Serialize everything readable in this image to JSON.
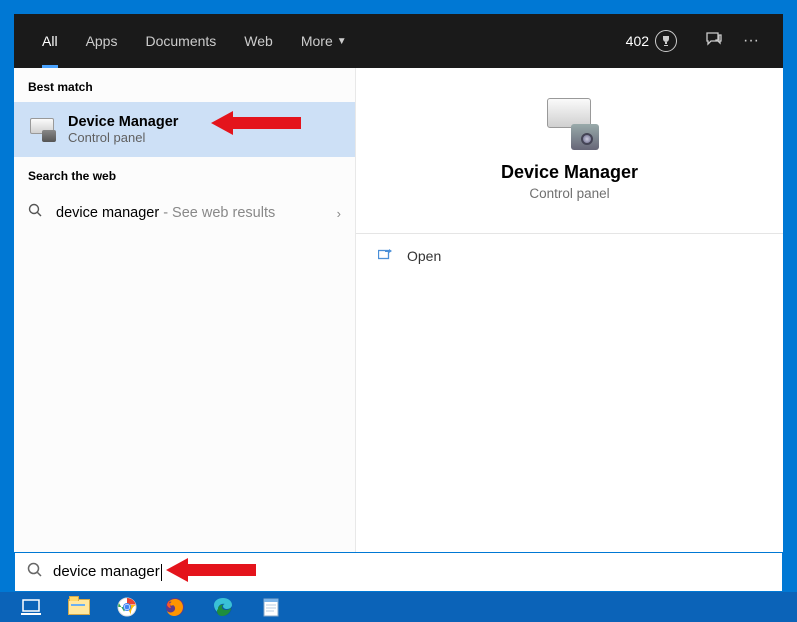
{
  "tabs": {
    "all": "All",
    "apps": "Apps",
    "documents": "Documents",
    "web": "Web",
    "more": "More"
  },
  "rewards": {
    "points": "402"
  },
  "left": {
    "best_match_header": "Best match",
    "best_match": {
      "title": "Device Manager",
      "subtitle": "Control panel"
    },
    "search_web_header": "Search the web",
    "web_result": {
      "query": "device manager",
      "hint": " - See web results"
    }
  },
  "detail": {
    "title": "Device Manager",
    "subtitle": "Control panel",
    "actions": {
      "open": "Open"
    }
  },
  "search": {
    "value": "device manager"
  }
}
